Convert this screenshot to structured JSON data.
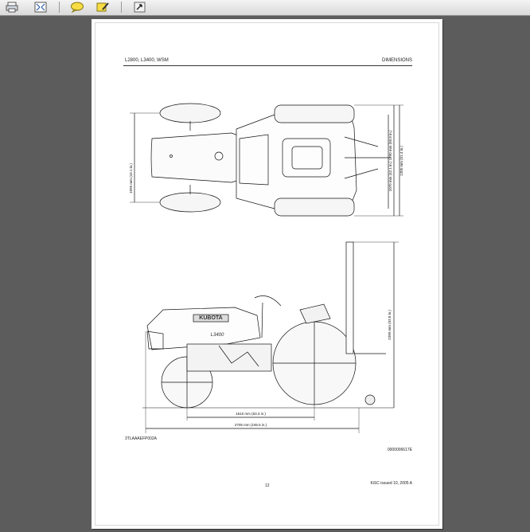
{
  "toolbar": {
    "buttons": [
      {
        "name": "print-icon"
      },
      {
        "name": "fit-page-icon"
      },
      {
        "name": "comment-icon"
      },
      {
        "name": "highlight-icon"
      },
      {
        "name": "tools-icon"
      }
    ]
  },
  "page": {
    "header_left": "L2800, L3400,  WSM",
    "header_right": "DIMENSIONS",
    "figure_code": "3TLAAAEFP002A",
    "doc_code": "0000006617E",
    "page_number": "12",
    "footer_right": "KiSC issued 10, 2005 A"
  },
  "dimensions": {
    "width_front": "1095 mm (43.1 in.)",
    "width_rear": "1070 mm (42.1 in.) 1290 mm (50.8 in.)",
    "overall_width": "1305 mm (51.4 in.)",
    "height": "2390 mm (93.8 in.)",
    "wheelbase": "1610 mm (63.3 in.)",
    "length": "2705 mm (106.5 in.)"
  },
  "brand": {
    "name": "KUBOTA",
    "model": "L3400"
  },
  "colors": {
    "background": "#5a5a5a",
    "page": "#ffffff",
    "ink": "#111111"
  }
}
